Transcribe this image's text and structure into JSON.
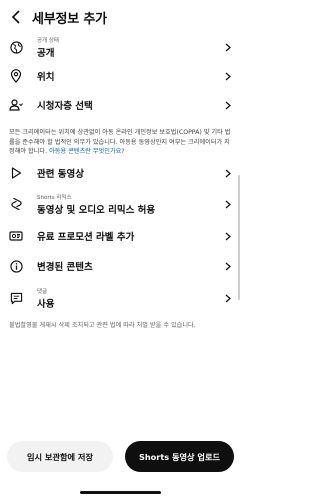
{
  "header": {
    "title": "세부정보 추가"
  },
  "rows": {
    "visibility": {
      "sublabel": "공개 상태",
      "label": "공개"
    },
    "location": {
      "label": "위치"
    },
    "audience": {
      "label": "시청자층 선택"
    },
    "related_video": {
      "label": "관련 동영상"
    },
    "remix": {
      "sublabel": "Shorts 리믹스",
      "label": "동영상 및 오디오 리믹스 허용"
    },
    "paid_promo": {
      "label": "유료 프로모션 라벨 추가"
    },
    "altered": {
      "label": "변경된 콘텐츠"
    },
    "comments": {
      "sublabel": "댓글",
      "label": "사용"
    }
  },
  "notice": {
    "text": "모든 크리에이터는 위치에 상관없이 아동 온라인 개인정보 보호법(COPPA) 및 기타 법률을 준수해야 할 법적인 의무가 있습니다. 아동용 동영상인지 여부는 크리에이터가 지정해야 합니다. ",
    "link": "아동용 콘텐츠란 무엇인가요?"
  },
  "footer_note": "불법촬영물 게재시 삭제 조치되고 관련 법에 따라 처벌 받을 수 있습니다.",
  "buttons": {
    "save_draft": "임시 보관함에 저장",
    "upload": "Shorts 동영상 업로드"
  }
}
